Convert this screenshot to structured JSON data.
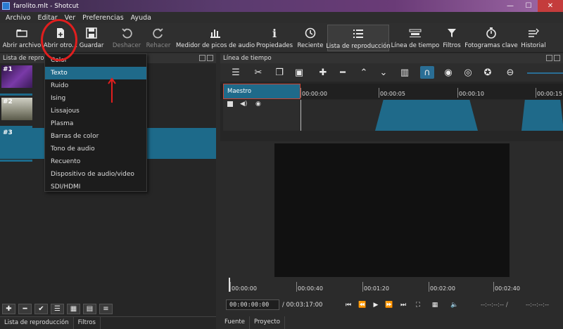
{
  "window": {
    "title": "farolito.mlt - Shotcut",
    "minimize": "—",
    "maximize": "☐",
    "close": "✕"
  },
  "menubar": [
    "Archivo",
    "Editar",
    "Ver",
    "Preferencias",
    "Ayuda"
  ],
  "toolbar": {
    "buttons": [
      {
        "label": "Abrir archivo",
        "icon": "folder-open-icon",
        "glyph": "▭"
      },
      {
        "label": "Abrir otro...",
        "icon": "open-other-icon",
        "glyph": "✚"
      },
      {
        "label": "Guardar",
        "icon": "save-icon",
        "glyph": "▣"
      },
      {
        "label": "Deshacer",
        "icon": "undo-icon",
        "glyph": "↶"
      },
      {
        "label": "Rehacer",
        "icon": "redo-icon",
        "glyph": "↷"
      },
      {
        "label": "Medidor de picos de audio",
        "icon": "audio-meter-icon",
        "glyph": "▥"
      },
      {
        "label": "Propiedades",
        "icon": "properties-icon",
        "glyph": "ℹ"
      },
      {
        "label": "Reciente",
        "icon": "clock-icon",
        "glyph": "◷"
      },
      {
        "label": "Lista de reproducción",
        "icon": "playlist-icon",
        "glyph": "☰"
      },
      {
        "label": "Línea de tiempo",
        "icon": "timeline-icon",
        "glyph": "▤"
      },
      {
        "label": "Filtros",
        "icon": "filter-icon",
        "glyph": "▼"
      },
      {
        "label": "Fotogramas clave",
        "icon": "stopwatch-icon",
        "glyph": "◴"
      },
      {
        "label": "Historial",
        "icon": "history-icon",
        "glyph": "⇶"
      }
    ]
  },
  "left_panel": {
    "title": "Lista de repro",
    "items": [
      {
        "num": "#1"
      },
      {
        "num": "#2"
      },
      {
        "num": "#3"
      }
    ],
    "tabs": [
      "Lista de reproducción",
      "Filtros"
    ]
  },
  "dropdown": {
    "items": [
      "Color",
      "Texto",
      "Ruido",
      "Ising",
      "Lissajous",
      "Plasma",
      "Barras de color",
      "Tono de audio",
      "Recuento",
      "Dispositivo de audio/video",
      "SDI/HDMI"
    ],
    "highlighted": "Texto"
  },
  "timeline": {
    "title": "Línea de tiempo",
    "master": "Maestro",
    "ticks": [
      "00:00:00",
      "00:00:05",
      "00:00:10",
      "00:00:15"
    ]
  },
  "player": {
    "scrub_ticks": [
      "00:00:00",
      "00:00:40",
      "00:01:20",
      "00:02:00",
      "00:02:40"
    ],
    "timecode": "00:00:00:00",
    "total": "/ 00:03:17:00",
    "in_point": "--:--:--:-- /",
    "out_point": "--:--:--:--",
    "tabs": [
      "Fuente",
      "Proyecto"
    ]
  },
  "colors": {
    "accent": "#1f6a8a",
    "annotation": "#e01e1e"
  }
}
